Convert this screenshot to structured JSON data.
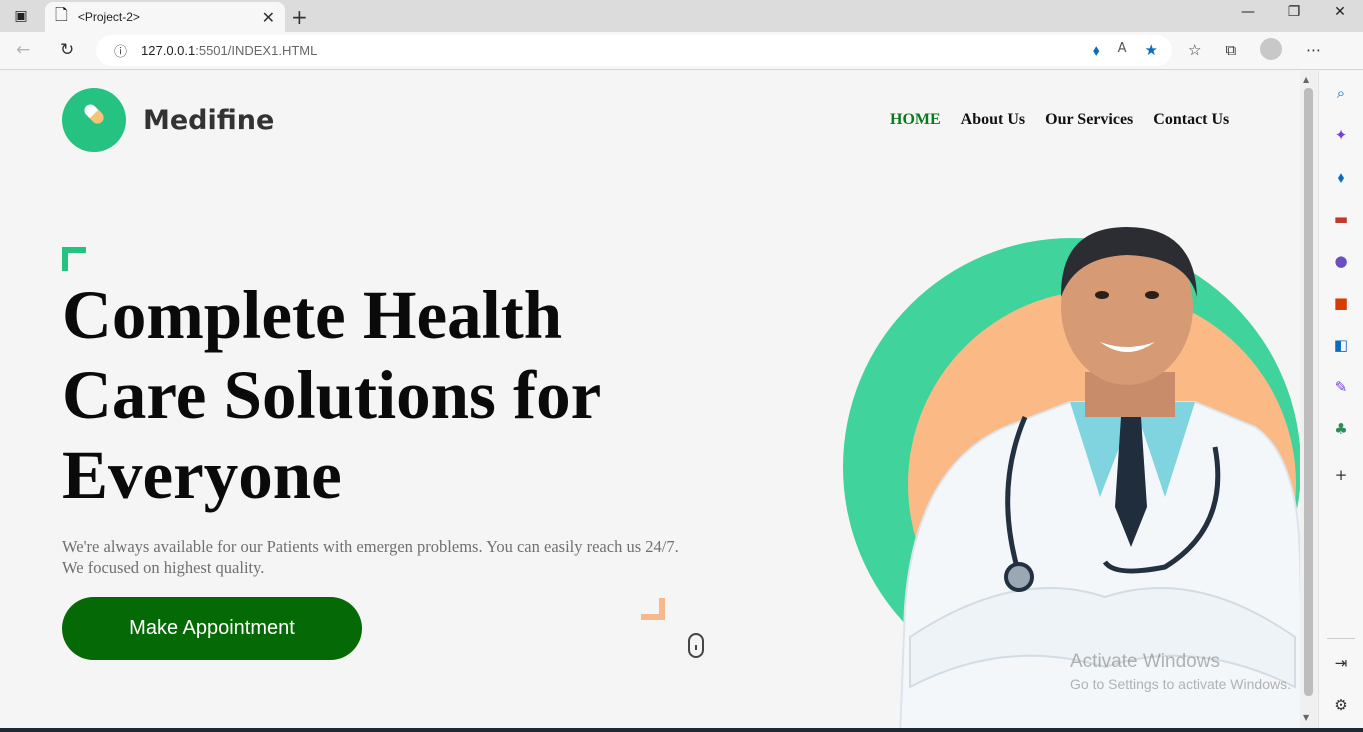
{
  "browser": {
    "tab_title": "<Project-2>",
    "url_host": "127.0.0.1",
    "url_rest": ":5501/INDEX1.HTML"
  },
  "site": {
    "brand": "Medifine",
    "nav": [
      {
        "label": "HOME",
        "active": true
      },
      {
        "label": "About Us",
        "active": false
      },
      {
        "label": "Our Services",
        "active": false
      },
      {
        "label": "Contact Us",
        "active": false
      }
    ]
  },
  "hero": {
    "headline": "Complete Health Care Solutions for Everyone",
    "subtext": "We're always available for our Patients with emergen problems. You can easily reach us 24/7. We focused on highest quality.",
    "cta_label": "Make Appointment"
  },
  "watermark": {
    "line1": "Activate Windows",
    "line2": "Go to Settings to activate Windows."
  },
  "colors": {
    "brand_green": "#26c281",
    "cta_green": "#056a05",
    "nav_active": "#0a7a1e",
    "accent_orange": "#fbb985"
  }
}
